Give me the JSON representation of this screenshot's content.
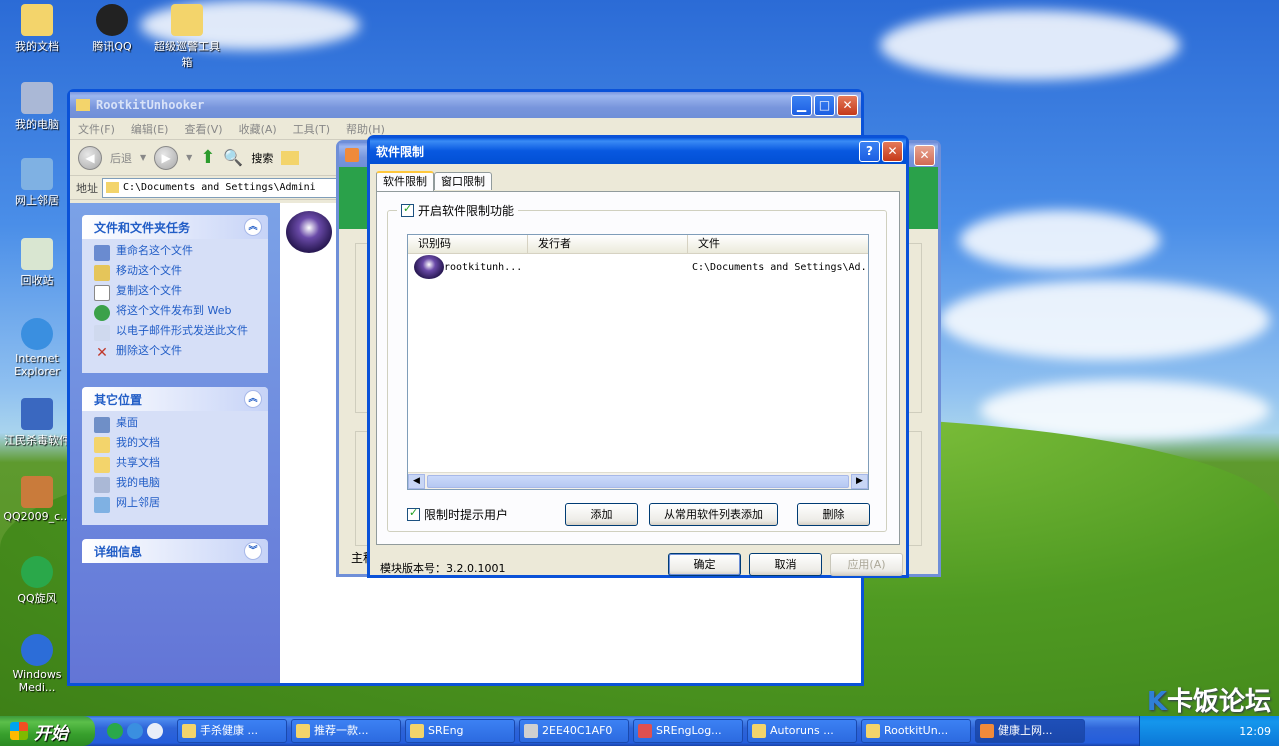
{
  "desktop": {
    "icons": [
      {
        "label": "我的文档"
      },
      {
        "label": "腾讯QQ"
      },
      {
        "label": "超级巡警工具箱"
      },
      {
        "label": "我的电脑"
      },
      {
        "label": "网上邻居"
      },
      {
        "label": "回收站"
      },
      {
        "label": "Internet Explorer"
      },
      {
        "label": "江民杀毒软件"
      },
      {
        "label": "QQ2009_c..."
      },
      {
        "label": "QQ旋风"
      },
      {
        "label": "Windows Medi..."
      }
    ]
  },
  "explorer": {
    "title": "RootkitUnhooker",
    "menu": [
      "文件(F)",
      "编辑(E)",
      "查看(V)",
      "收藏(A)",
      "工具(T)",
      "帮助(H)"
    ],
    "toolbar": {
      "back": "后退",
      "search": "搜索"
    },
    "address": {
      "label": "地址",
      "value": "C:\\Documents and Settings\\Admini"
    },
    "tasks_panel": {
      "title": "文件和文件夹任务",
      "items": [
        "重命名这个文件",
        "移动这个文件",
        "复制这个文件",
        "将这个文件发布到 Web",
        "以电子邮件形式发送此文件",
        "删除这个文件"
      ]
    },
    "places_panel": {
      "title": "其它位置",
      "items": [
        "桌面",
        "我的文档",
        "共享文档",
        "我的电脑",
        "网上邻居"
      ]
    },
    "details_panel": {
      "title": "详细信息"
    }
  },
  "behind_window": {
    "footer_label": "主程"
  },
  "dialog": {
    "title": "软件限制",
    "tabs": [
      "软件限制",
      "窗口限制"
    ],
    "enable_label": "开启软件限制功能",
    "columns": [
      "识别码",
      "发行者",
      "文件"
    ],
    "rows": [
      {
        "id": "rootkitunh...",
        "publisher": "",
        "file": "C:\\Documents and Settings\\Ad."
      }
    ],
    "prompt_label": "限制时提示用户",
    "btn_add": "添加",
    "btn_add_common": "从常用软件列表添加",
    "btn_delete": "删除",
    "version": "模块版本号：3.2.0.1001",
    "btn_ok": "确定",
    "btn_cancel": "取消",
    "btn_apply": "应用(A)"
  },
  "taskbar": {
    "start": "开始",
    "tasks": [
      "手杀健康 ...",
      "推荐一款...",
      "SREng",
      "2EE40C1AF0",
      "SREngLog...",
      "Autoruns ...",
      "RootkitUn...",
      "健康上网..."
    ],
    "clock": "12:09"
  },
  "watermark": "卡饭论坛",
  "colors": {
    "xp_blue": "#0a52d8",
    "link_blue": "#215dc6",
    "start_green": "#38a02d"
  }
}
